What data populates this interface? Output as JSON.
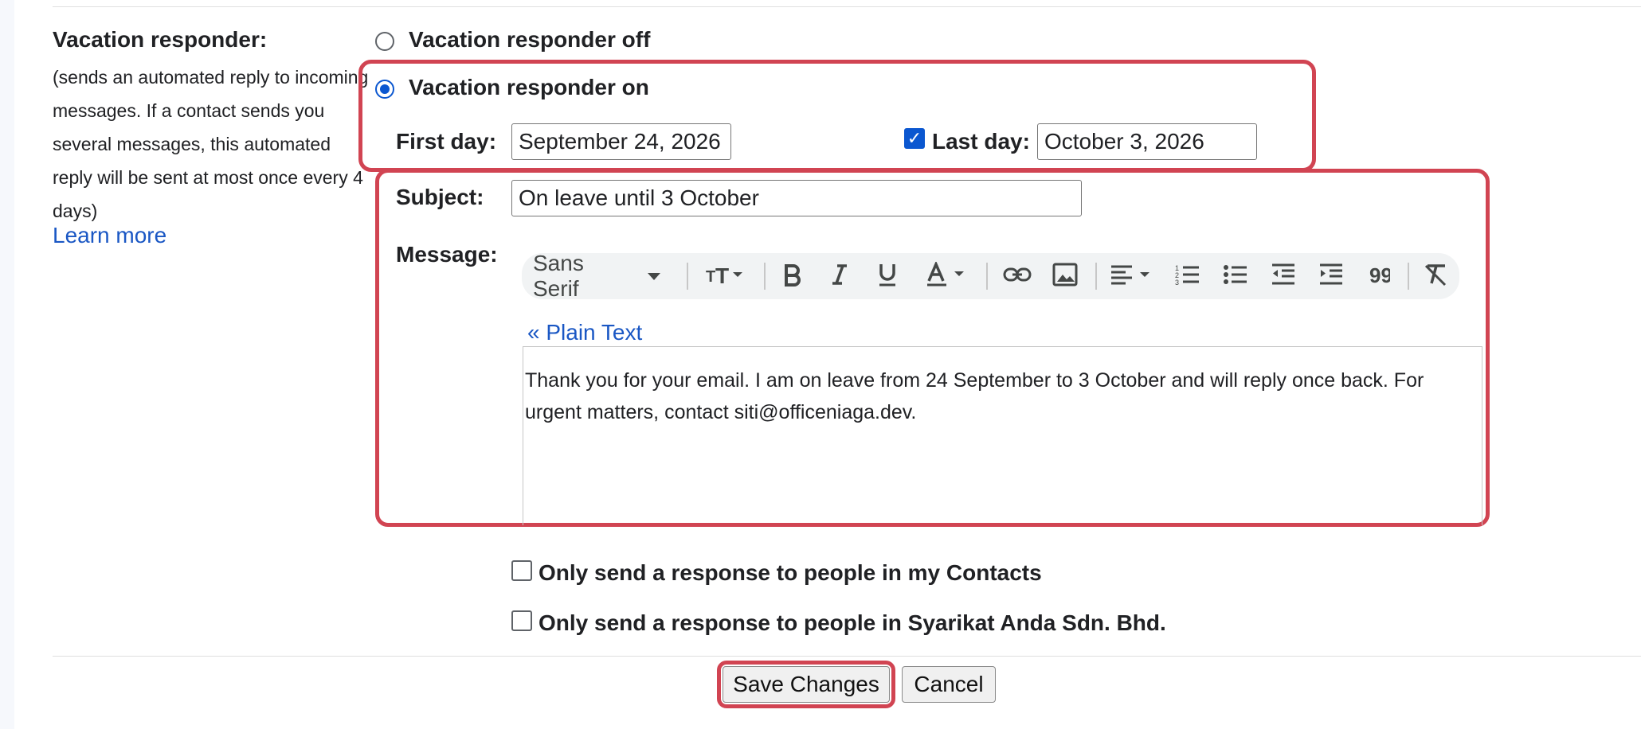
{
  "section": {
    "label": "Vacation responder:",
    "description": "(sends an automated reply to incoming messages. If a contact sends you several messages, this automated reply will be sent at most once every 4 days)",
    "learn_more": "Learn more"
  },
  "responder": {
    "off_label": "Vacation responder off",
    "on_label": "Vacation responder on",
    "selected": "on"
  },
  "dates": {
    "first_day_label": "First day:",
    "first_day_value": "September 24, 2026",
    "last_day_label": "Last day:",
    "last_day_value": "October 3, 2026",
    "last_day_checked": true
  },
  "subject": {
    "label": "Subject:",
    "value": "On leave until 3 October"
  },
  "message": {
    "label": "Message:",
    "toolbar": {
      "font": "Sans Serif",
      "icons": [
        "text-size-icon",
        "bold-icon",
        "italic-icon",
        "underline-icon",
        "text-color-icon",
        "link-icon",
        "image-icon",
        "align-icon",
        "numbered-list-icon",
        "bulleted-list-icon",
        "indent-less-icon",
        "indent-more-icon",
        "quote-icon",
        "remove-formatting-icon"
      ]
    },
    "plain_text_link": "« Plain Text",
    "body": "Thank you for your email. I am on leave from 24 September to 3 October and will reply once back. For urgent matters, contact siti@officeniaga.dev."
  },
  "options": {
    "contacts_only": "Only send a response to people in my Contacts",
    "domain_only": "Only send a response to people in Syarikat Anda Sdn. Bhd."
  },
  "actions": {
    "save": "Save Changes",
    "cancel": "Cancel"
  },
  "colors": {
    "accent": "#0b57d0",
    "link": "#1a57c4",
    "highlight": "#d14452"
  }
}
